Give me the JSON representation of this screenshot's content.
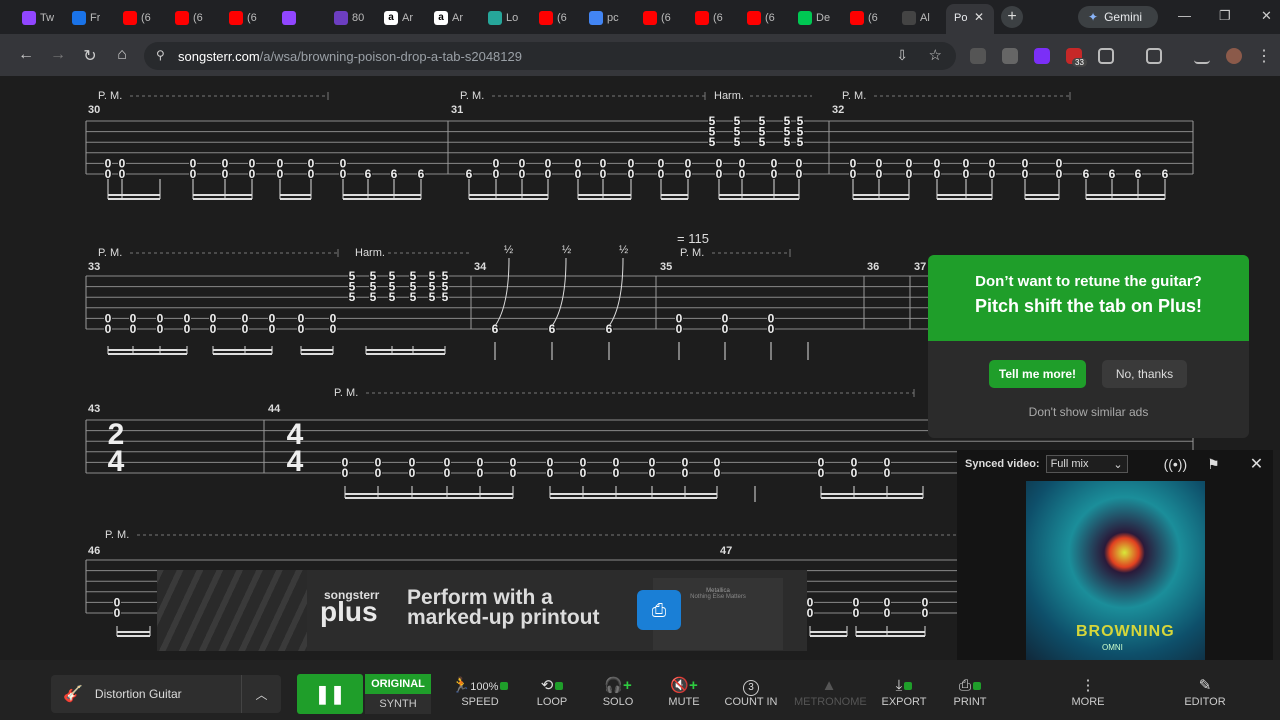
{
  "browser": {
    "tabs": [
      {
        "label": "Tw",
        "icon": "twitch-icon",
        "color": "#9146ff"
      },
      {
        "label": "Fr",
        "icon": "info-icon",
        "color": "#1a73e8"
      },
      {
        "label": "(6",
        "icon": "youtube-icon",
        "color": "#ff0000"
      },
      {
        "label": "(6",
        "icon": "youtube-icon",
        "color": "#ff0000"
      },
      {
        "label": "(6",
        "icon": "youtube-icon",
        "color": "#ff0000"
      },
      {
        "label": "",
        "icon": "twitch-icon",
        "color": "#9146ff"
      },
      {
        "label": "80",
        "icon": "app-icon",
        "color": "#6c3ec1"
      },
      {
        "label": "Ar",
        "icon": "amazon-icon",
        "color": "#ffffff"
      },
      {
        "label": "Ar",
        "icon": "amazon-icon",
        "color": "#ffffff"
      },
      {
        "label": "Lo",
        "icon": "globe-icon",
        "color": "#26a69a"
      },
      {
        "label": "(6",
        "icon": "youtube-icon",
        "color": "#ff0000"
      },
      {
        "label": "pc",
        "icon": "google-icon",
        "color": "#4285f4"
      },
      {
        "label": "(6",
        "icon": "youtube-icon",
        "color": "#ff0000"
      },
      {
        "label": "(6",
        "icon": "youtube-icon",
        "color": "#ff0000"
      },
      {
        "label": "(6",
        "icon": "youtube-icon",
        "color": "#ff0000"
      },
      {
        "label": "De",
        "icon": "k-icon",
        "color": "#00c853"
      },
      {
        "label": "(6",
        "icon": "youtube-icon",
        "color": "#ff0000"
      },
      {
        "label": "Al",
        "icon": "app-icon",
        "color": "#444444"
      }
    ],
    "active_tab": {
      "label": "Po"
    },
    "gemini_label": "Gemini",
    "url_domain": "songsterr.com",
    "url_path": "/a/wsa/browning-poison-drop-a-tab-s2048129",
    "extension_badge": "33"
  },
  "sheet": {
    "annotations": {
      "pm": "P. M.",
      "harm": "Harm.",
      "half": "½",
      "tempo": "= 115"
    },
    "bars": [
      "30",
      "31",
      "32",
      "33",
      "34",
      "35",
      "36",
      "37",
      "43",
      "44",
      "46",
      "47"
    ],
    "time_signature": {
      "top": "4",
      "bottom": "4",
      "bar43_top": "2",
      "bar43_bottom": "4"
    },
    "frets": {
      "zero": "0",
      "six": "6",
      "five": "5"
    }
  },
  "ad": {
    "question": "Don’t want to retune the guitar?",
    "pitch": "Pitch shift the tab on Plus!",
    "tell_label": "Tell me more!",
    "no_label": "No, thanks",
    "dont_show": "Don't show similar ads"
  },
  "video": {
    "label": "Synced video:",
    "mix": "Full mix",
    "album_logo": "BROWNING",
    "album_sub": "OMNI"
  },
  "banner": {
    "brand_top": "songsterr",
    "brand_bottom": "plus",
    "headline_1": "Perform with a",
    "headline_2": "marked-up printout",
    "sheet_title": "Metallica",
    "sheet_sub": "Nothing Else Matters"
  },
  "toolbar": {
    "instrument": "Distortion Guitar",
    "original": "ORIGINAL",
    "synth": "SYNTH",
    "speed_value": "100%",
    "speed": "SPEED",
    "loop": "LOOP",
    "solo": "SOLO",
    "mute": "MUTE",
    "count_in_value": "3",
    "count_in": "COUNT IN",
    "metronome": "METRONOME",
    "export": "EXPORT",
    "print": "PRINT",
    "more": "MORE",
    "editor": "EDITOR"
  },
  "colors": {
    "accent": "#1f9e2a",
    "print_blue": "#1a7fd6"
  }
}
